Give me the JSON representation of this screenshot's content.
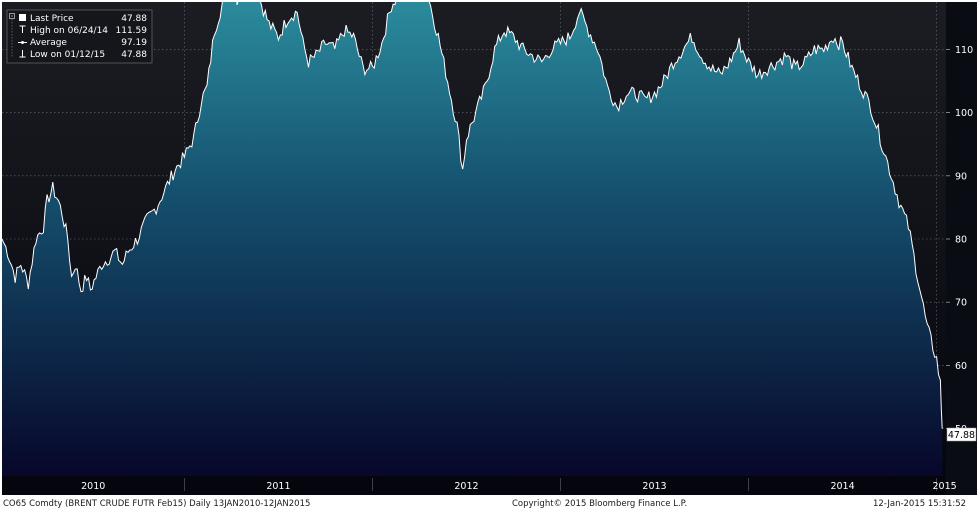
{
  "legend": {
    "items": [
      {
        "icon": "square-icon",
        "label": "Last Price",
        "value": "47.88"
      },
      {
        "icon": "high-marker-icon",
        "label": "High on 06/24/14",
        "value": "111.59"
      },
      {
        "icon": "average-marker-icon",
        "label": "Average",
        "value": "97.19"
      },
      {
        "icon": "low-marker-icon",
        "label": "Low on 01/12/15",
        "value": "47.88"
      }
    ]
  },
  "last_price_tag": "47.88",
  "footer": {
    "left": "CO65 Comdty (BRENT CRUDE FUTR  Feb15)  Daily  13JAN2010-12JAN2015",
    "center": "Copyright© 2015 Bloomberg Finance L.P.",
    "right": "12-Jan-2015 15:31:52"
  },
  "colors": {
    "background_top": "#1b1d23",
    "background_bottom": "#05060d",
    "area_top": "#2f97a6",
    "area_bottom": "#07072a",
    "line": "#ffffff"
  },
  "chart_data": {
    "type": "area",
    "title": "",
    "xlabel": "",
    "ylabel": "",
    "x_ticks": [
      "2010",
      "2011",
      "2012",
      "2013",
      "2014",
      "2015"
    ],
    "y_ticks": [
      50,
      60,
      70,
      80,
      90,
      100,
      110
    ],
    "ylim": [
      42.5,
      117.5
    ],
    "xlim": [
      2010.03,
      2015.05
    ],
    "grid": true,
    "legend_position": "top-left",
    "series": [
      {
        "x": [
          2010.03,
          2010.06,
          2010.1,
          2010.13,
          2010.17,
          2010.21,
          2010.25,
          2010.27,
          2010.3,
          2010.33,
          2010.35,
          2010.38,
          2010.4,
          2010.42,
          2010.45,
          2010.48,
          2010.5,
          2010.53,
          2010.56,
          2010.6,
          2010.63,
          2010.67,
          2010.7,
          2010.75,
          2010.8,
          2010.85,
          2010.9,
          2010.95,
          2011.0,
          2011.05,
          2011.09,
          2011.12,
          2011.16,
          2011.2,
          2011.25,
          2011.28,
          2011.32,
          2011.36,
          2011.4,
          2011.45,
          2011.5,
          2011.55,
          2011.6,
          2011.63,
          2011.66,
          2011.7,
          2011.75,
          2011.8,
          2011.85,
          2011.9,
          2011.95,
          2012.0,
          2012.05,
          2012.1,
          2012.15,
          2012.2,
          2012.25,
          2012.3,
          2012.35,
          2012.4,
          2012.45,
          2012.48,
          2012.5,
          2012.55,
          2012.6,
          2012.65,
          2012.7,
          2012.75,
          2012.8,
          2012.85,
          2012.9,
          2012.95,
          2013.0,
          2013.05,
          2013.1,
          2013.15,
          2013.2,
          2013.25,
          2013.3,
          2013.35,
          2013.4,
          2013.45,
          2013.5,
          2013.55,
          2013.6,
          2013.65,
          2013.7,
          2013.75,
          2013.8,
          2013.85,
          2013.9,
          2013.95,
          2014.0,
          2014.05,
          2014.1,
          2014.15,
          2014.2,
          2014.25,
          2014.3,
          2014.35,
          2014.4,
          2014.45,
          2014.48,
          2014.5,
          2014.55,
          2014.6,
          2014.65,
          2014.7,
          2014.75,
          2014.8,
          2014.85,
          2014.9,
          2014.95,
          2015.0,
          2015.02,
          2015.03
        ],
        "y": [
          80.0,
          78.0,
          74.0,
          76.0,
          73.0,
          80.0,
          82.0,
          86.0,
          88.0,
          86.0,
          84.0,
          80.0,
          74.0,
          76.0,
          72.0,
          74.0,
          72.0,
          74.0,
          76.0,
          77.0,
          78.0,
          76.0,
          78.0,
          80.0,
          83.0,
          85.0,
          88.0,
          91.0,
          93.0,
          96.0,
          102.0,
          104.0,
          113.0,
          117.0,
          124.0,
          118.0,
          120.0,
          122.0,
          118.0,
          114.0,
          112.0,
          115.0,
          116.0,
          111.0,
          108.0,
          109.0,
          111.0,
          110.0,
          113.0,
          112.0,
          107.0,
          107.0,
          111.0,
          117.0,
          119.0,
          123.0,
          121.0,
          118.0,
          112.0,
          105.0,
          98.0,
          91.0,
          96.0,
          100.0,
          104.0,
          110.0,
          113.0,
          112.0,
          110.0,
          109.0,
          108.0,
          110.0,
          111.0,
          112.0,
          116.0,
          113.0,
          110.0,
          104.0,
          101.0,
          103.0,
          103.0,
          102.0,
          103.0,
          105.0,
          108.0,
          110.0,
          112.0,
          109.0,
          107.0,
          106.0,
          108.0,
          111.0,
          108.0,
          106.0,
          107.0,
          108.0,
          109.0,
          107.0,
          108.0,
          110.0,
          110.0,
          112.0,
          111.0,
          111.0,
          107.0,
          104.0,
          101.0,
          96.0,
          91.0,
          86.0,
          82.0,
          74.0,
          66.0,
          61.0,
          57.0,
          50.0
        ]
      }
    ]
  }
}
